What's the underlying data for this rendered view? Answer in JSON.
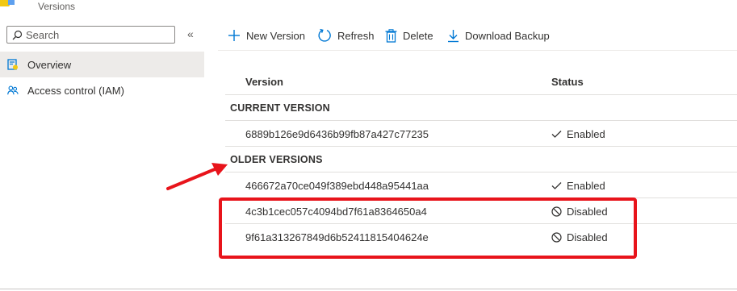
{
  "header": {
    "subtitle": "Versions"
  },
  "sidebar": {
    "search_placeholder": "Search",
    "collapse_glyph": "«",
    "items": [
      {
        "label": "Overview",
        "icon": "overview-icon",
        "active": true
      },
      {
        "label": "Access control (IAM)",
        "icon": "people-icon",
        "active": false
      }
    ]
  },
  "toolbar": {
    "new_version": "New Version",
    "refresh": "Refresh",
    "delete": "Delete",
    "download_backup": "Download Backup"
  },
  "table": {
    "headers": {
      "version": "Version",
      "status": "Status"
    },
    "current_section": "CURRENT VERSION",
    "older_section": "OLDER VERSIONS",
    "current": [
      {
        "version": "6889b126e9d6436b99fb87a427c77235",
        "status": "Enabled"
      }
    ],
    "older": [
      {
        "version": "466672a70ce049f389ebd448a95441aa",
        "status": "Enabled"
      },
      {
        "version": "4c3b1cec057c4094bd7f61a8364650a4",
        "status": "Disabled"
      },
      {
        "version": "9f61a313267849d6b52411815404624e",
        "status": "Disabled"
      }
    ]
  },
  "colors": {
    "accent": "#0078d4",
    "annotation": "#e8141b",
    "active_nav": "#edebe9"
  }
}
